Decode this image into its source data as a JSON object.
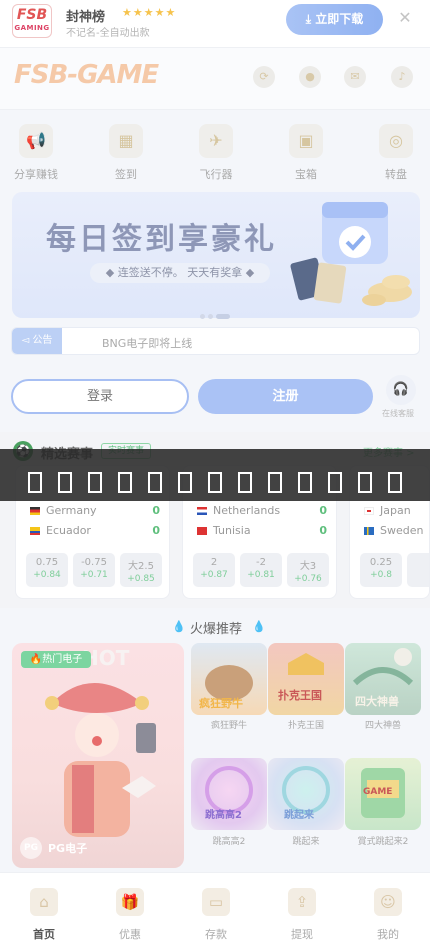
{
  "app_banner": {
    "logo_text": "FSB",
    "logo_sub": "GAMING",
    "name": "封神榜",
    "stars": "★★★★★",
    "subtitle": "不记名-全自动出款",
    "download_label": "立即下载",
    "close": "✕"
  },
  "header": {
    "logo": "FSB-GAME",
    "icons": [
      "refresh-icon",
      "coin-icon",
      "message-icon",
      "bell-icon"
    ]
  },
  "quick_menu": [
    {
      "label": "分享赚钱",
      "icon": "megaphone-icon",
      "glyph": "📢"
    },
    {
      "label": "签到",
      "icon": "calendar-icon",
      "glyph": "📅"
    },
    {
      "label": "飞行器",
      "icon": "plane-icon",
      "glyph": "✈"
    },
    {
      "label": "宝箱",
      "icon": "chest-icon",
      "glyph": "🎁"
    },
    {
      "label": "转盘",
      "icon": "wheel-icon",
      "glyph": "◎"
    }
  ],
  "promo": {
    "title": "每日签到享豪礼",
    "subtitle": "◆ 连签送不停。 天天有奖拿 ◆"
  },
  "notice": {
    "tag": "公告",
    "text": "BNG电子即将上线"
  },
  "auth": {
    "login": "登录",
    "register": "注册",
    "support": "在线客服"
  },
  "sports": {
    "title": "精选赛事",
    "tag": "实时赛事",
    "more": "更多赛事 >",
    "matches": [
      {
        "home": "Germany",
        "away": "Ecuador",
        "home_score": "0",
        "away_score": "0",
        "odds": [
          {
            "o": "0.75",
            "g": "+0.84"
          },
          {
            "o": "-0.75",
            "g": "+0.71"
          },
          {
            "o": "大2.5",
            "g": "+0.85"
          }
        ]
      },
      {
        "home": "Netherlands",
        "away": "Tunisia",
        "home_score": "0",
        "away_score": "0",
        "odds": [
          {
            "o": "2",
            "g": "+0.87"
          },
          {
            "o": "-2",
            "g": "+0.81"
          },
          {
            "o": "大3",
            "g": "+0.76"
          }
        ]
      },
      {
        "home": "Japan",
        "away": "Sweden",
        "home_score": "",
        "away_score": "",
        "odds": [
          {
            "o": "0.25",
            "g": "+0.8"
          },
          {
            "o": "",
            "g": ""
          },
          {
            "o": "",
            "g": ""
          }
        ]
      }
    ]
  },
  "hot": {
    "title": "火爆推荐",
    "featured_badge": "🔥热门电子",
    "featured_provider": "PG电子",
    "games": [
      "疯狂野牛",
      "扑克王国",
      "四大神兽",
      "跳高高2",
      "跳起来",
      "賞式跳起来2"
    ]
  },
  "tabbar": [
    {
      "label": "首页",
      "icon": "home-icon",
      "glyph": "⌂"
    },
    {
      "label": "优惠",
      "icon": "gift-icon",
      "glyph": "🎁"
    },
    {
      "label": "存款",
      "icon": "wallet-icon",
      "glyph": "▭"
    },
    {
      "label": "提现",
      "icon": "withdraw-icon",
      "glyph": "⇪"
    },
    {
      "label": "我的",
      "icon": "profile-icon",
      "glyph": "☺"
    }
  ],
  "colors": {
    "accent_blue": "#aac2f5",
    "green": "#5fbf7d",
    "overlay": "#282828"
  }
}
